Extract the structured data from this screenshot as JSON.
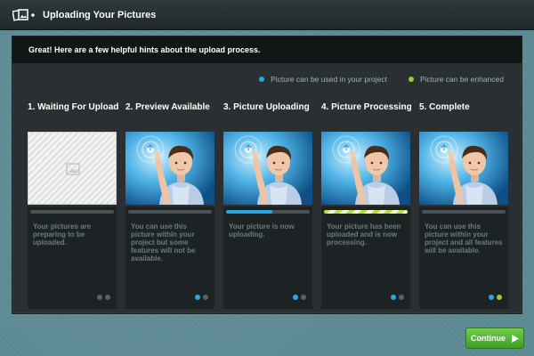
{
  "window": {
    "title": "Uploading Your Pictures"
  },
  "hint": {
    "text": "Great! Here are a few helpful hints about the upload process."
  },
  "legend": {
    "blue_label": "Picture can be used in your project",
    "green_label": "Picture can be enhanced",
    "blue_color": "#2aa7e0",
    "green_color": "#8fd12d"
  },
  "steps": [
    {
      "label": "1. Waiting For Upload",
      "description": "Your pictures are preparing to be uploaded.",
      "progress": 0,
      "image": "placeholder-image-icon",
      "dots": [
        "grey",
        "grey"
      ]
    },
    {
      "label": "2. Preview Available",
      "description": "You can use this picture within your project but some features will not be available.",
      "progress": 0,
      "image": "boy-touching-screen-photo",
      "dots": [
        "blue",
        "grey"
      ]
    },
    {
      "label": "3. Picture Uploading",
      "description": "Your picture is now uploading.",
      "progress": 0.55,
      "image": "boy-touching-screen-photo",
      "dots": [
        "blue",
        "grey"
      ]
    },
    {
      "label": "4. Picture Processing",
      "description": "Your picture has been uploaded and is now processing.",
      "progress": 1,
      "image": "boy-touching-screen-photo",
      "dots": [
        "blue",
        "grey"
      ]
    },
    {
      "label": "5. Complete",
      "description": "You can use this picture within your project and all features will be available.",
      "progress": 0,
      "image": "boy-touching-screen-photo",
      "dots": [
        "blue",
        "green"
      ]
    }
  ],
  "actions": {
    "continue_label": "Continue"
  }
}
